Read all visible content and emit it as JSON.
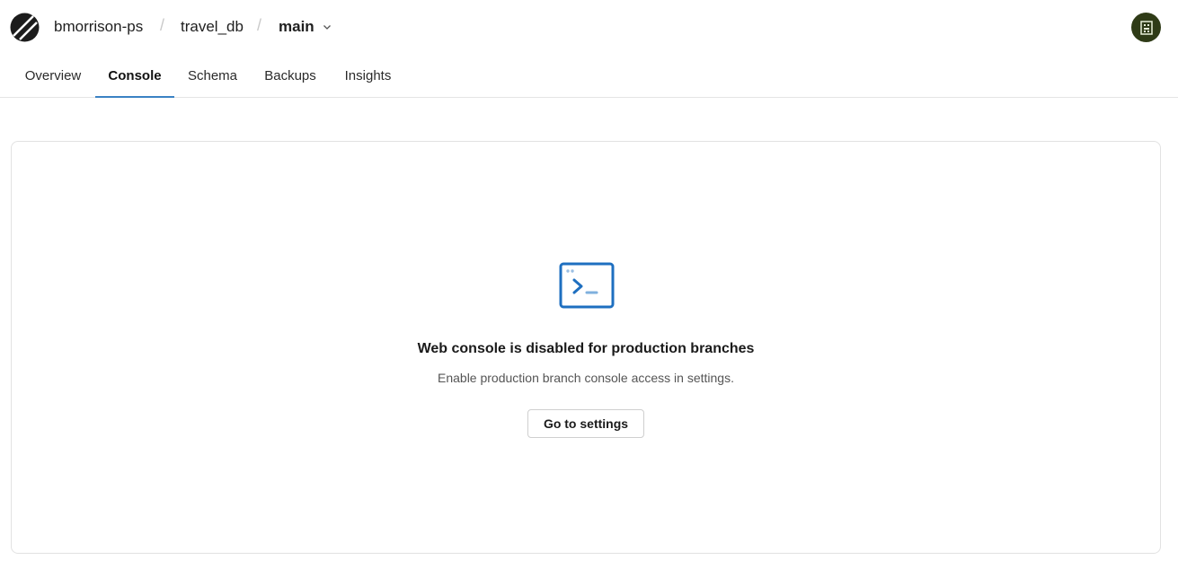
{
  "header": {
    "org": "bmorrison-ps",
    "separator": "/",
    "database": "travel_db",
    "branch": "main",
    "logo_icon": "planetscale-logo-icon",
    "branch_dropdown_icon": "chevron-down-icon",
    "avatar_icon": "user-avatar-icon"
  },
  "tabs": [
    {
      "label": "Overview",
      "active": false
    },
    {
      "label": "Console",
      "active": true
    },
    {
      "label": "Schema",
      "active": false
    },
    {
      "label": "Backups",
      "active": false
    },
    {
      "label": "Insights",
      "active": false
    }
  ],
  "empty_state": {
    "icon": "terminal-icon",
    "title": "Web console is disabled for production branches",
    "subtitle": "Enable production branch console access in settings.",
    "button_label": "Go to settings"
  },
  "colors": {
    "accent": "#3b82c4",
    "icon_blue": "#1e6fc0",
    "avatar_bg": "#2f3b17"
  }
}
